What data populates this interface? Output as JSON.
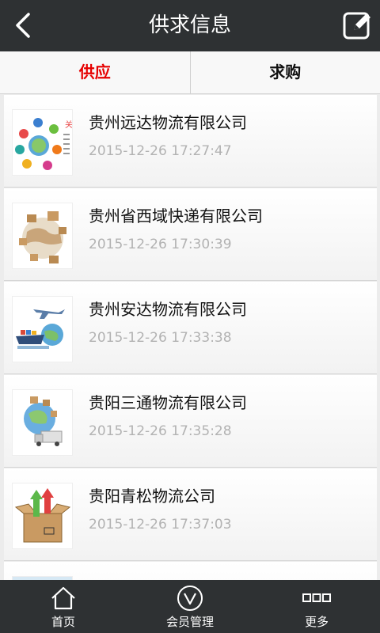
{
  "header": {
    "title": "供求信息"
  },
  "tabs": [
    {
      "label": "供应",
      "active": true
    },
    {
      "label": "求购",
      "active": false
    }
  ],
  "items": [
    {
      "name": "贵州远达物流有限公司",
      "time": "2015-12-26 17:27:47",
      "image": "logistics-network-diagram"
    },
    {
      "name": "贵州省西域快递有限公司",
      "time": "2015-12-26 17:30:39",
      "image": "globe-with-parcels"
    },
    {
      "name": "贵州安达物流有限公司",
      "time": "2015-12-26 17:33:38",
      "image": "plane-ship-globe"
    },
    {
      "name": "贵阳三通物流有限公司",
      "time": "2015-12-26 17:35:28",
      "image": "globe-with-truck"
    },
    {
      "name": "贵阳青松物流公司",
      "time": "2015-12-26 17:37:03",
      "image": "box-with-arrows"
    }
  ],
  "bottom_nav": [
    {
      "label": "首页",
      "icon": "home-icon"
    },
    {
      "label": "会员管理",
      "icon": "member-v-icon"
    },
    {
      "label": "更多",
      "icon": "more-icon"
    }
  ],
  "colors": {
    "header_bg": "#2e3133",
    "active_tab": "#e60000",
    "timestamp": "#b2b2b2"
  }
}
